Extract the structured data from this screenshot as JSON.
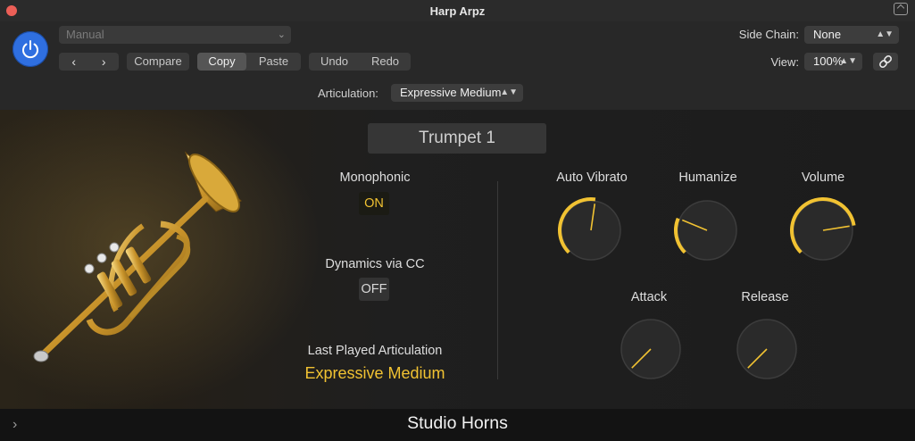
{
  "window": {
    "title": "Harp Arpz"
  },
  "header": {
    "preset": "Manual",
    "nav": {
      "prev": "‹",
      "next": "›"
    },
    "buttons": {
      "compare": "Compare",
      "copy": "Copy",
      "paste": "Paste",
      "undo": "Undo",
      "redo": "Redo"
    },
    "side_chain": {
      "label": "Side Chain:",
      "value": "None"
    },
    "view": {
      "label": "View:",
      "value": "100%"
    },
    "articulation": {
      "label": "Articulation:",
      "value": "Expressive Medium"
    }
  },
  "instrument": {
    "name": "Trumpet 1",
    "monophonic": {
      "label": "Monophonic",
      "value": "ON"
    },
    "dynamics": {
      "label": "Dynamics via CC",
      "value": "OFF"
    },
    "last_articulation": {
      "label": "Last Played Articulation",
      "value": "Expressive Medium"
    }
  },
  "knobs": {
    "auto_vibrato": {
      "label": "Auto Vibrato",
      "level": 0.53
    },
    "humanize": {
      "label": "Humanize",
      "level": 0.25
    },
    "volume": {
      "label": "Volume",
      "level": 0.8
    },
    "attack": {
      "label": "Attack",
      "level": 0.0
    },
    "release": {
      "label": "Release",
      "level": 0.0
    }
  },
  "footer": {
    "plugin_name": "Studio Horns"
  },
  "colors": {
    "accent": "#f1c232",
    "power": "#2f6fe0",
    "close": "#ec5f57"
  }
}
